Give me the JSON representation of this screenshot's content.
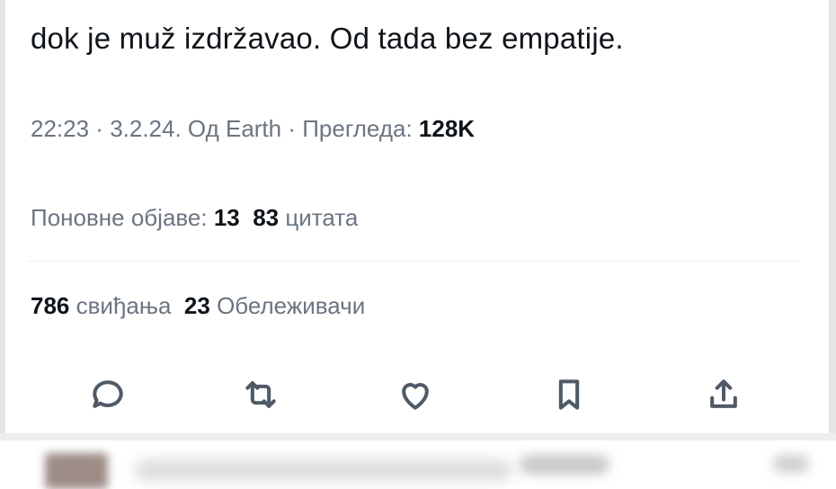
{
  "tweet": {
    "text_line": "dok je muž izdržavao. Od tada bez empatije."
  },
  "meta": {
    "time": "22:23",
    "sep1": " · ",
    "date": "3.2.24.",
    "source": " Од Earth",
    "sep2": " · ",
    "views_label": "Прегледа: ",
    "views_count": "128K"
  },
  "engagement": {
    "reposts_label": "Поновне објаве: ",
    "reposts_count": "13",
    "quotes_count": "83",
    "quotes_label": " цитата",
    "likes_count": "786",
    "likes_label": " свиђања",
    "bookmarks_count": "23",
    "bookmarks_label": " Обележивачи"
  },
  "actions": [
    {
      "name": "reply",
      "icon": "speech-bubble-icon"
    },
    {
      "name": "repost",
      "icon": "repost-arrows-icon"
    },
    {
      "name": "like",
      "icon": "heart-icon"
    },
    {
      "name": "bookmark",
      "icon": "bookmark-icon"
    },
    {
      "name": "share",
      "icon": "share-upload-icon"
    }
  ],
  "colors": {
    "text": "#0f1419",
    "secondary": "#6b7580",
    "icon": "#4f5a66",
    "divider": "#e9ecef"
  }
}
